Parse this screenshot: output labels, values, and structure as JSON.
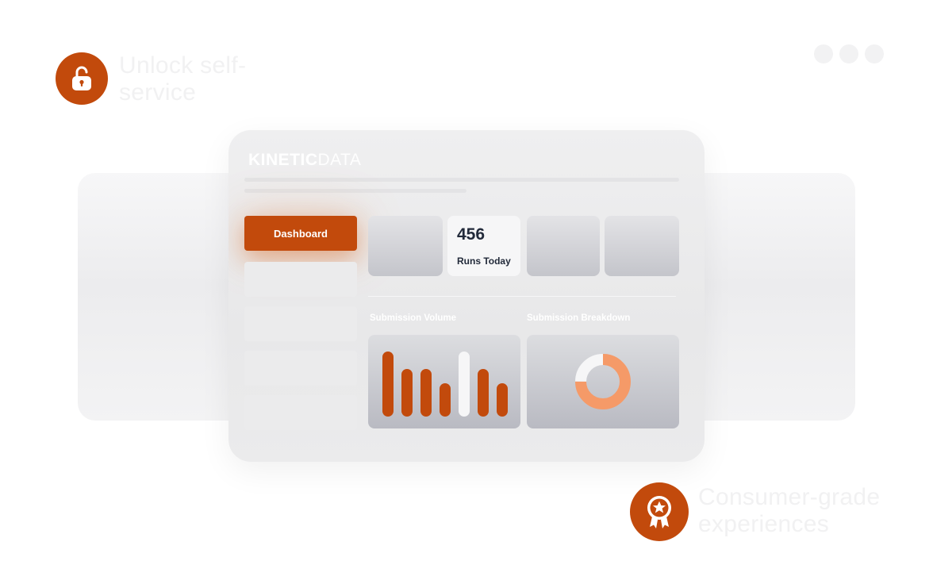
{
  "features": [
    {
      "icon": "lock-open-icon",
      "text": "Unlock self-service"
    },
    {
      "icon": "award-star-icon",
      "text": "Consumer-grade experiences"
    }
  ],
  "app": {
    "logo_bold": "KINETIC",
    "logo_light": "DATA",
    "nav": {
      "active_label": "Dashboard"
    },
    "stat": {
      "value": "456",
      "label": "Runs Today"
    },
    "sections": {
      "volume_title": "Submission Volume",
      "breakdown_title": "Submission Breakdown"
    }
  },
  "colors": {
    "accent": "#c24a0c",
    "donut_light": "#f59a68",
    "highlight_bar": "#f6f6f7"
  },
  "chart_data": [
    {
      "type": "bar",
      "values": [
        1.0,
        0.73,
        0.73,
        0.51,
        1.0,
        0.73,
        0.51
      ],
      "highlight_index": 4
    },
    {
      "type": "pie",
      "values": [
        0.75,
        0.25
      ]
    }
  ]
}
